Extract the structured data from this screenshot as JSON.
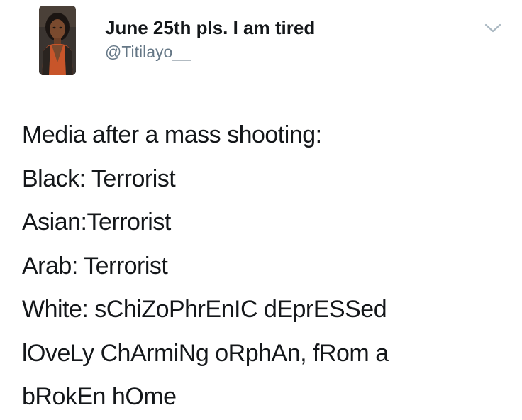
{
  "user": {
    "display_name": "June 25th pls. I am tired",
    "handle": "@Titilayo__",
    "avatar_icon": "profile-avatar"
  },
  "menu": {
    "icon": "chevron-down-icon"
  },
  "tweet": {
    "lines": [
      "Media after a mass shooting:",
      "Black: Terrorist",
      "Asian:Terrorist",
      "Arab: Terrorist",
      "White: sChiZoPhrEnIC dEprESSed",
      "lOveLy ChArmiNg oRphAn, fRom a",
      "bRokEn hOme"
    ]
  }
}
